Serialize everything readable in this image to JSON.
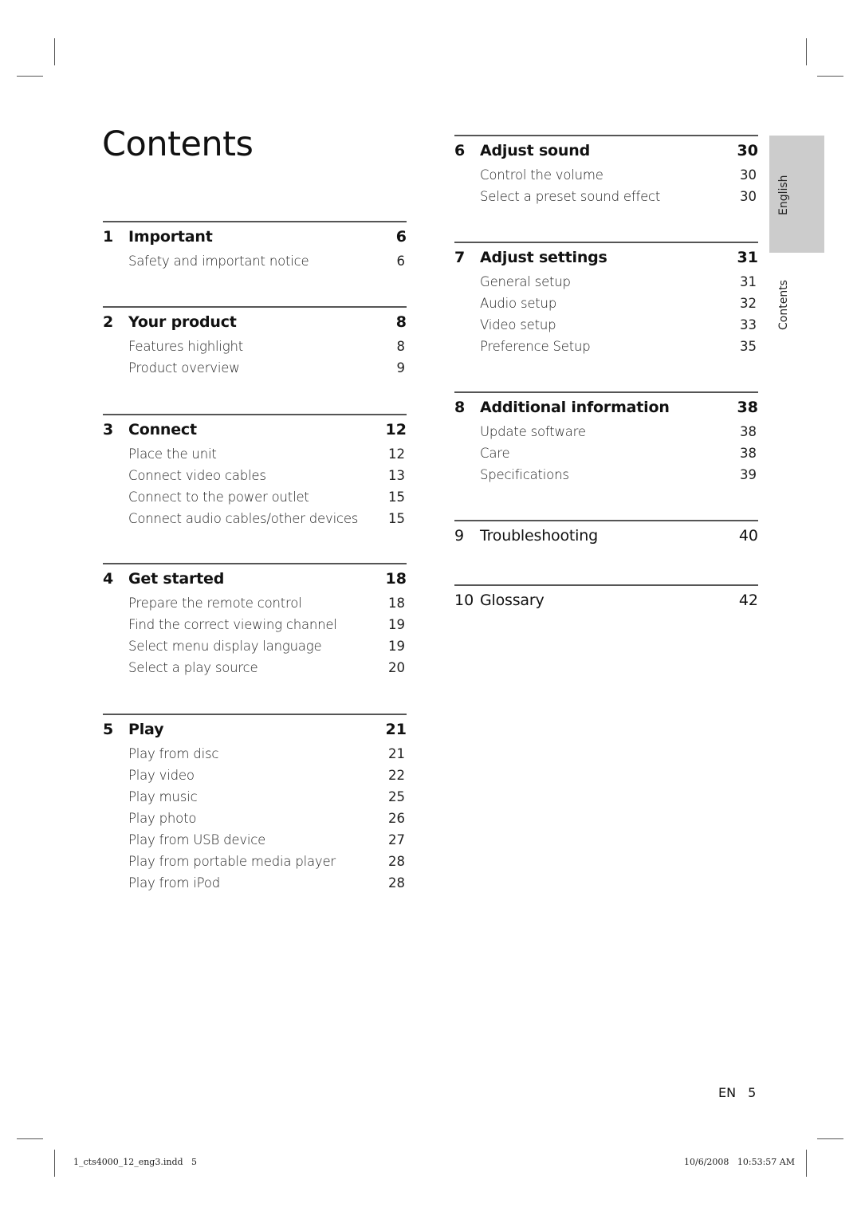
{
  "page_title": "Contents",
  "side_tabs": {
    "language": "English",
    "section": "Contents"
  },
  "left_column": [
    {
      "number": "1",
      "title": "Important",
      "page": "6",
      "items": [
        {
          "label": "Safety and important notice",
          "page": "6"
        }
      ]
    },
    {
      "number": "2",
      "title": "Your product",
      "page": "8",
      "items": [
        {
          "label": "Features highlight",
          "page": "8"
        },
        {
          "label": "Product overview",
          "page": "9"
        }
      ]
    },
    {
      "number": "3",
      "title": "Connect",
      "page": "12",
      "items": [
        {
          "label": "Place the unit",
          "page": "12"
        },
        {
          "label": "Connect video cables",
          "page": "13"
        },
        {
          "label": "Connect to the power outlet",
          "page": "15"
        },
        {
          "label": "Connect audio cables/other devices",
          "page": "15"
        }
      ]
    },
    {
      "number": "4",
      "title": "Get started",
      "page": "18",
      "items": [
        {
          "label": "Prepare the remote control",
          "page": "18"
        },
        {
          "label": "Find the correct viewing channel",
          "page": "19"
        },
        {
          "label": "Select menu display language",
          "page": "19"
        },
        {
          "label": "Select a play source",
          "page": "20"
        }
      ]
    },
    {
      "number": "5",
      "title": "Play",
      "page": "21",
      "items": [
        {
          "label": "Play from disc",
          "page": "21"
        },
        {
          "label": "Play video",
          "page": "22"
        },
        {
          "label": "Play music",
          "page": "25"
        },
        {
          "label": "Play photo",
          "page": "26"
        },
        {
          "label": "Play from USB device",
          "page": "27"
        },
        {
          "label": "Play from portable media player",
          "page": "28"
        },
        {
          "label": "Play from iPod",
          "page": "28"
        }
      ]
    }
  ],
  "right_column": [
    {
      "number": "6",
      "title": "Adjust sound",
      "page": "30",
      "items": [
        {
          "label": "Control the volume",
          "page": "30"
        },
        {
          "label": "Select a preset sound effect",
          "page": "30"
        }
      ]
    },
    {
      "number": "7",
      "title": "Adjust settings",
      "page": "31",
      "items": [
        {
          "label": "General setup",
          "page": "31"
        },
        {
          "label": "Audio setup",
          "page": "32"
        },
        {
          "label": "Video setup",
          "page": "33"
        },
        {
          "label": "Preference Setup",
          "page": "35"
        }
      ]
    },
    {
      "number": "8",
      "title": "Additional information",
      "page": "38",
      "items": [
        {
          "label": "Update software",
          "page": "38"
        },
        {
          "label": "Care",
          "page": "38"
        },
        {
          "label": "Specifications",
          "page": "39"
        }
      ]
    },
    {
      "number": "9",
      "title": "Troubleshooting",
      "page": "40",
      "items": []
    },
    {
      "number": "10",
      "title": "Glossary",
      "page": "42",
      "items": []
    }
  ],
  "page_number": {
    "lang": "EN",
    "number": "5"
  },
  "footer": {
    "file": "1_cts4000_12_eng3.indd   5",
    "timestamp": "10/6/2008   10:53:57 AM"
  },
  "colors": {
    "side_tab": "#cccccc",
    "rule": "#555555",
    "text": "#111111"
  }
}
